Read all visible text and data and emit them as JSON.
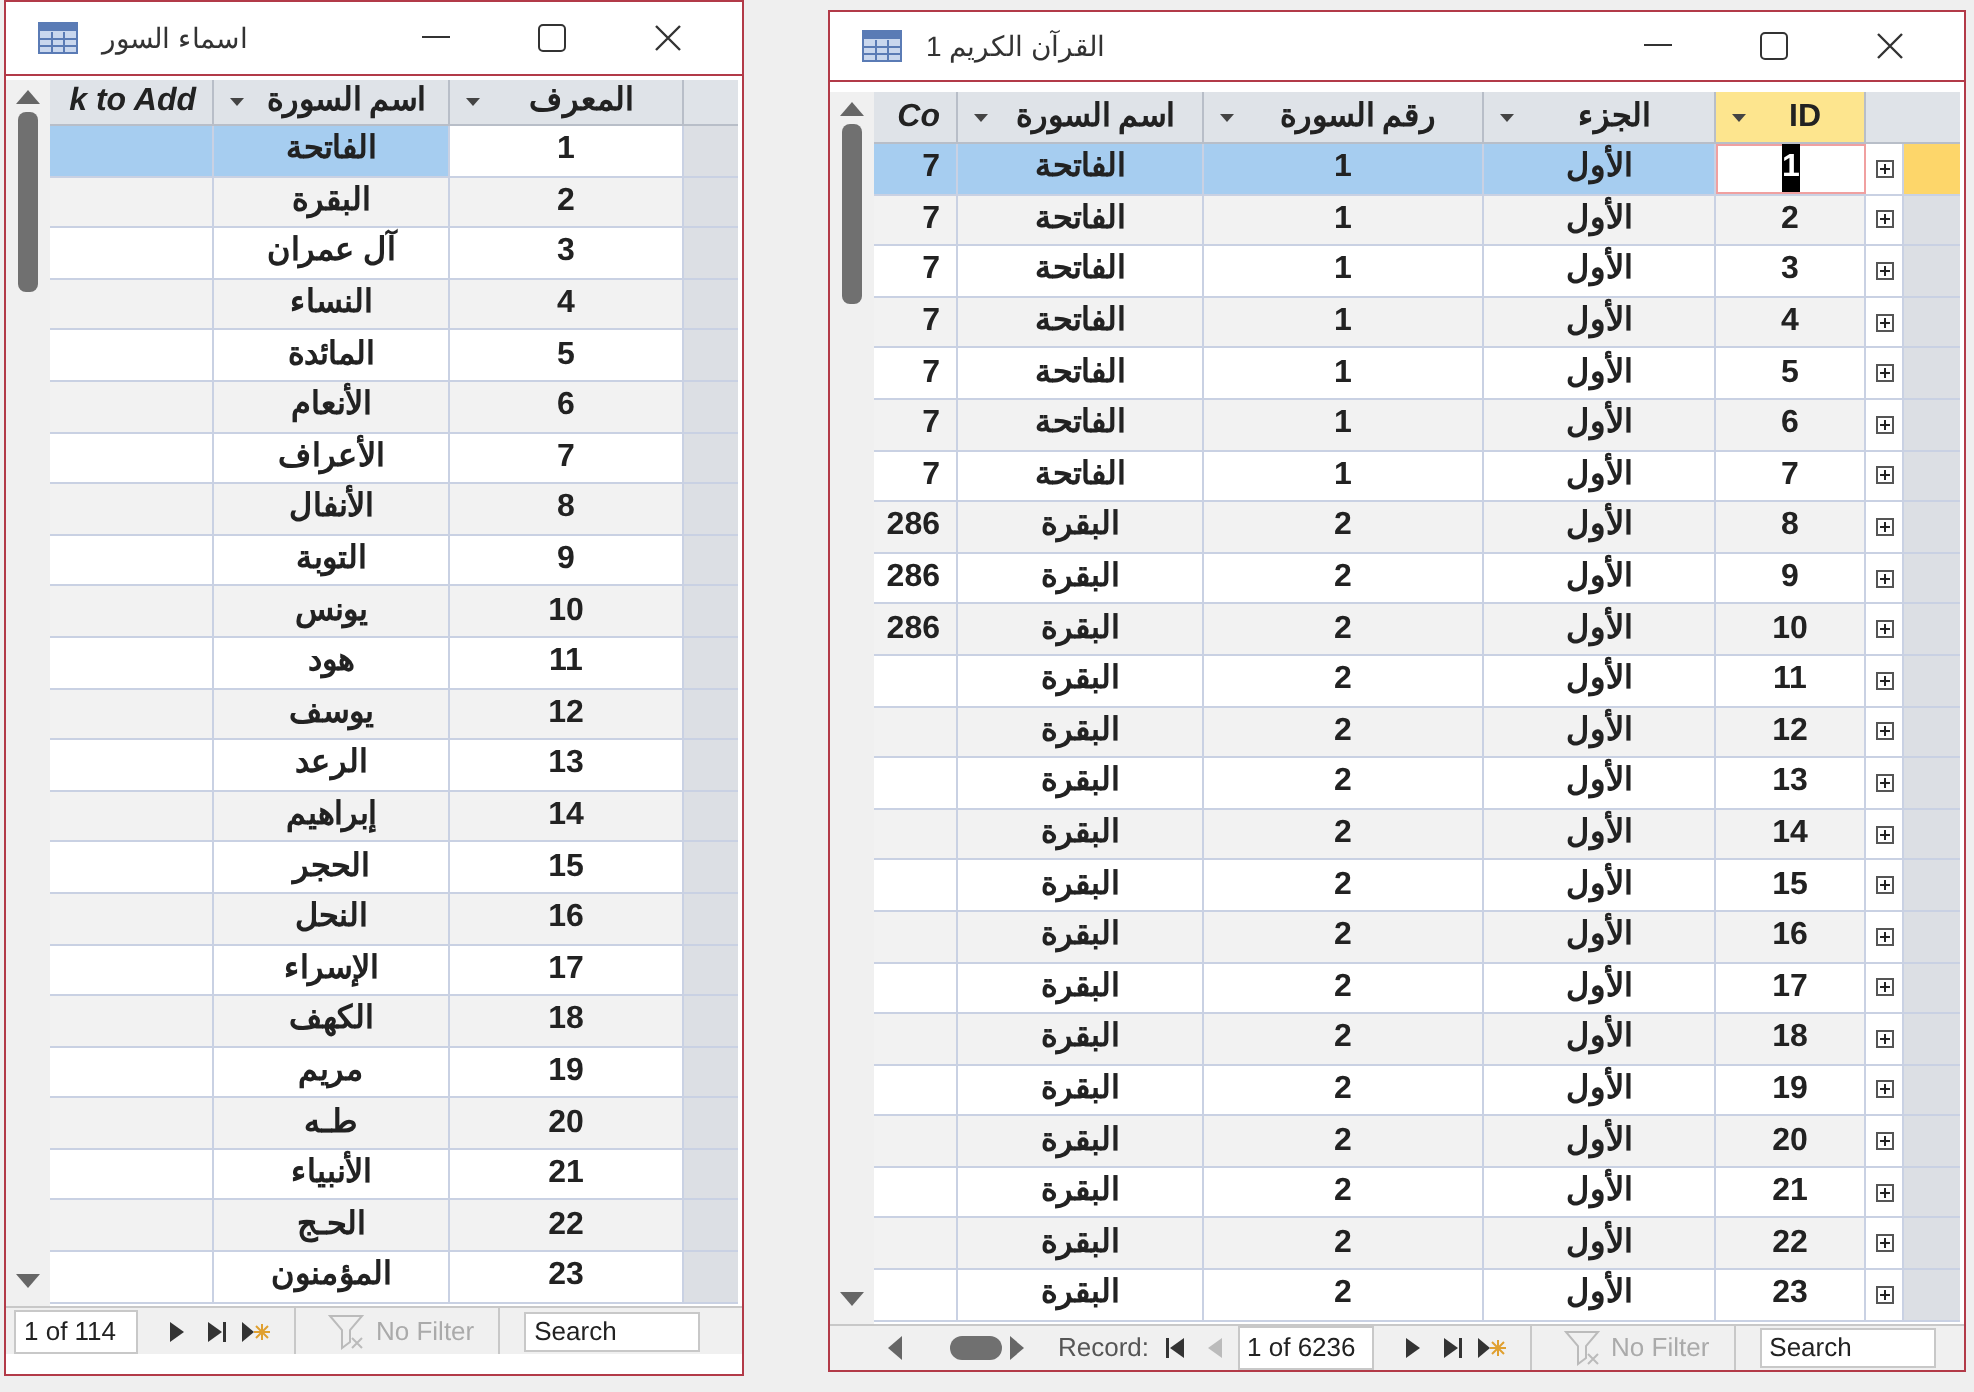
{
  "windows": [
    {
      "title": "القرآن الكريم 1",
      "columns": [
        {
          "label": "ID",
          "kind": "id"
        },
        {
          "label": "الجزء",
          "kind": "juz"
        },
        {
          "label": "رقم السورة",
          "kind": "number"
        },
        {
          "label": "اسم السورة",
          "kind": "name"
        },
        {
          "label": "Co",
          "kind": "co"
        }
      ],
      "rows": [
        {
          "id": "1",
          "juz": "الأول",
          "number": "1",
          "name": "الفاتحة",
          "co": "7",
          "selected": true
        },
        {
          "id": "2",
          "juz": "الأول",
          "number": "1",
          "name": "الفاتحة",
          "co": "7",
          "selected": false
        },
        {
          "id": "3",
          "juz": "الأول",
          "number": "1",
          "name": "الفاتحة",
          "co": "7",
          "selected": false
        },
        {
          "id": "4",
          "juz": "الأول",
          "number": "1",
          "name": "الفاتحة",
          "co": "7",
          "selected": false
        },
        {
          "id": "5",
          "juz": "الأول",
          "number": "1",
          "name": "الفاتحة",
          "co": "7",
          "selected": false
        },
        {
          "id": "6",
          "juz": "الأول",
          "number": "1",
          "name": "الفاتحة",
          "co": "7",
          "selected": false
        },
        {
          "id": "7",
          "juz": "الأول",
          "number": "1",
          "name": "الفاتحة",
          "co": "7",
          "selected": false
        },
        {
          "id": "8",
          "juz": "الأول",
          "number": "2",
          "name": "البقرة",
          "co": "286",
          "selected": false
        },
        {
          "id": "9",
          "juz": "الأول",
          "number": "2",
          "name": "البقرة",
          "co": "286",
          "selected": false
        },
        {
          "id": "10",
          "juz": "الأول",
          "number": "2",
          "name": "البقرة",
          "co": "286",
          "selected": false
        },
        {
          "id": "11",
          "juz": "الأول",
          "number": "2",
          "name": "البقرة",
          "selected": false
        },
        {
          "id": "12",
          "juz": "الأول",
          "number": "2",
          "name": "البقرة",
          "selected": false
        },
        {
          "id": "13",
          "juz": "الأول",
          "number": "2",
          "name": "البقرة",
          "selected": false
        },
        {
          "id": "14",
          "juz": "الأول",
          "number": "2",
          "name": "البقرة",
          "selected": false
        },
        {
          "id": "15",
          "juz": "الأول",
          "number": "2",
          "name": "البقرة",
          "selected": false
        },
        {
          "id": "16",
          "juz": "الأول",
          "number": "2",
          "name": "البقرة",
          "selected": false
        },
        {
          "id": "17",
          "juz": "الأول",
          "number": "2",
          "name": "البقرة",
          "selected": false
        },
        {
          "id": "18",
          "juz": "الأول",
          "number": "2",
          "name": "البقرة",
          "selected": false
        },
        {
          "id": "19",
          "juz": "الأول",
          "number": "2",
          "name": "البقرة",
          "selected": false
        },
        {
          "id": "20",
          "juz": "الأول",
          "number": "2",
          "name": "البقرة",
          "selected": false
        },
        {
          "id": "21",
          "juz": "الأول",
          "number": "2",
          "name": "البقرة",
          "selected": false
        },
        {
          "id": "22",
          "juz": "الأول",
          "number": "2",
          "name": "البقرة",
          "selected": false
        },
        {
          "id": "23",
          "juz": "الأول",
          "number": "2",
          "name": "البقرة",
          "selected": false
        }
      ],
      "footer": {
        "label": "Record:",
        "record": "1 of 6236",
        "filter": "No Filter",
        "search": "Search"
      }
    },
    {
      "title": "اسماء السور",
      "columns": [
        {
          "label": "المعرف",
          "kind": "id"
        },
        {
          "label": "اسم السورة",
          "kind": "name"
        },
        {
          "label": "k to Add",
          "kind": "add"
        }
      ],
      "rows": [
        {
          "id": "1",
          "name": "الفاتحة",
          "selected": true
        },
        {
          "id": "2",
          "name": "البقرة",
          "selected": false
        },
        {
          "id": "3",
          "name": "آل عمران",
          "selected": false
        },
        {
          "id": "4",
          "name": "النساء",
          "selected": false
        },
        {
          "id": "5",
          "name": "المائدة",
          "selected": false
        },
        {
          "id": "6",
          "name": "الأنعام",
          "selected": false
        },
        {
          "id": "7",
          "name": "الأعراف",
          "selected": false
        },
        {
          "id": "8",
          "name": "الأنفال",
          "selected": false
        },
        {
          "id": "9",
          "name": "التوبة",
          "selected": false
        },
        {
          "id": "10",
          "name": "يونس",
          "selected": false
        },
        {
          "id": "11",
          "name": "هود",
          "selected": false
        },
        {
          "id": "12",
          "name": "يوسف",
          "selected": false
        },
        {
          "id": "13",
          "name": "الرعد",
          "selected": false
        },
        {
          "id": "14",
          "name": "إبراهيم",
          "selected": false
        },
        {
          "id": "15",
          "name": "الحجر",
          "selected": false
        },
        {
          "id": "16",
          "name": "النحل",
          "selected": false
        },
        {
          "id": "17",
          "name": "الإسراء",
          "selected": false
        },
        {
          "id": "18",
          "name": "الكهف",
          "selected": false
        },
        {
          "id": "19",
          "name": "مريم",
          "selected": false
        },
        {
          "id": "20",
          "name": "طـه",
          "selected": false
        },
        {
          "id": "21",
          "name": "الأنبياء",
          "selected": false
        },
        {
          "id": "22",
          "name": "الحـج",
          "selected": false
        },
        {
          "id": "23",
          "name": "المؤمنون",
          "selected": false
        }
      ],
      "footer": {
        "record": "1 of 114",
        "filter": "No Filter",
        "search": "Search"
      }
    }
  ]
}
